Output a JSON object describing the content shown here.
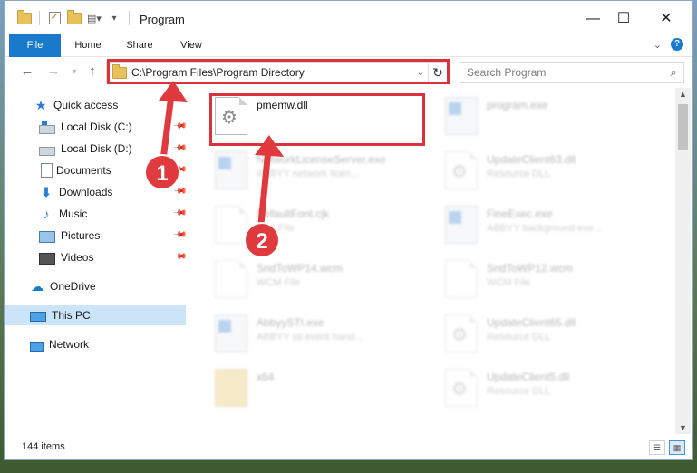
{
  "titlebar": {
    "title": "Program",
    "minimize": "—",
    "maximize": "☐",
    "close": "✕"
  },
  "ribbon": {
    "tabs": [
      "File",
      "Home",
      "Share",
      "View"
    ],
    "help": "?"
  },
  "navigation": {
    "back": "←",
    "forward": "→",
    "up": "↑",
    "address": "C:\\Program Files\\Program Directory",
    "search_placeholder": "Search Program"
  },
  "sidebar": {
    "quick_access": "Quick access",
    "items": [
      {
        "label": "Local Disk (C:)",
        "icon": "local-disk-c-icon"
      },
      {
        "label": "Local Disk (D:)",
        "icon": "local-disk-d-icon"
      },
      {
        "label": "Documents",
        "icon": "documents-icon"
      },
      {
        "label": "Downloads",
        "icon": "downloads-icon"
      },
      {
        "label": "Music",
        "icon": "music-icon"
      },
      {
        "label": "Pictures",
        "icon": "pictures-icon"
      },
      {
        "label": "Videos",
        "icon": "videos-icon"
      }
    ],
    "onedrive": "OneDrive",
    "this_pc": "This PC",
    "network": "Network"
  },
  "files": [
    {
      "name": "pmemw.dll",
      "type": "",
      "icon": "dll-gear-icon",
      "highlighted": true
    },
    {
      "name": "program.exe",
      "type": "",
      "icon": "exe-icon"
    },
    {
      "name": "NetworkLicenseServer.exe",
      "type": "ABBYY network licen...",
      "icon": "exe-icon"
    },
    {
      "name": "UpdateClient63.dll",
      "type": "Resource DLL",
      "icon": "dll-gear-icon"
    },
    {
      "name": "DefaultFont.cjk",
      "type": "CJK File",
      "icon": "file-icon"
    },
    {
      "name": "FineExec.exe",
      "type": "ABBYY background exe...",
      "icon": "exe-icon"
    },
    {
      "name": "SndToWP14.wcm",
      "type": "WCM File",
      "icon": "file-icon"
    },
    {
      "name": "SndToWP12.wcm",
      "type": "WCM File",
      "icon": "file-icon"
    },
    {
      "name": "AbbyySTI.exe",
      "type": "ABBYY sti event hand...",
      "icon": "exe-icon"
    },
    {
      "name": "UpdateClient65.dll",
      "type": "Resource DLL",
      "icon": "dll-gear-icon"
    },
    {
      "name": "x64",
      "type": "",
      "icon": "folder-icon"
    },
    {
      "name": "UpdateClient5.dll",
      "type": "Resource DLL",
      "icon": "dll-gear-icon"
    }
  ],
  "status": {
    "item_count": "144 items"
  },
  "callouts": [
    "1",
    "2"
  ],
  "colors": {
    "accent": "#1979ca",
    "highlight": "#d9323a",
    "selected": "#cce4f7"
  }
}
